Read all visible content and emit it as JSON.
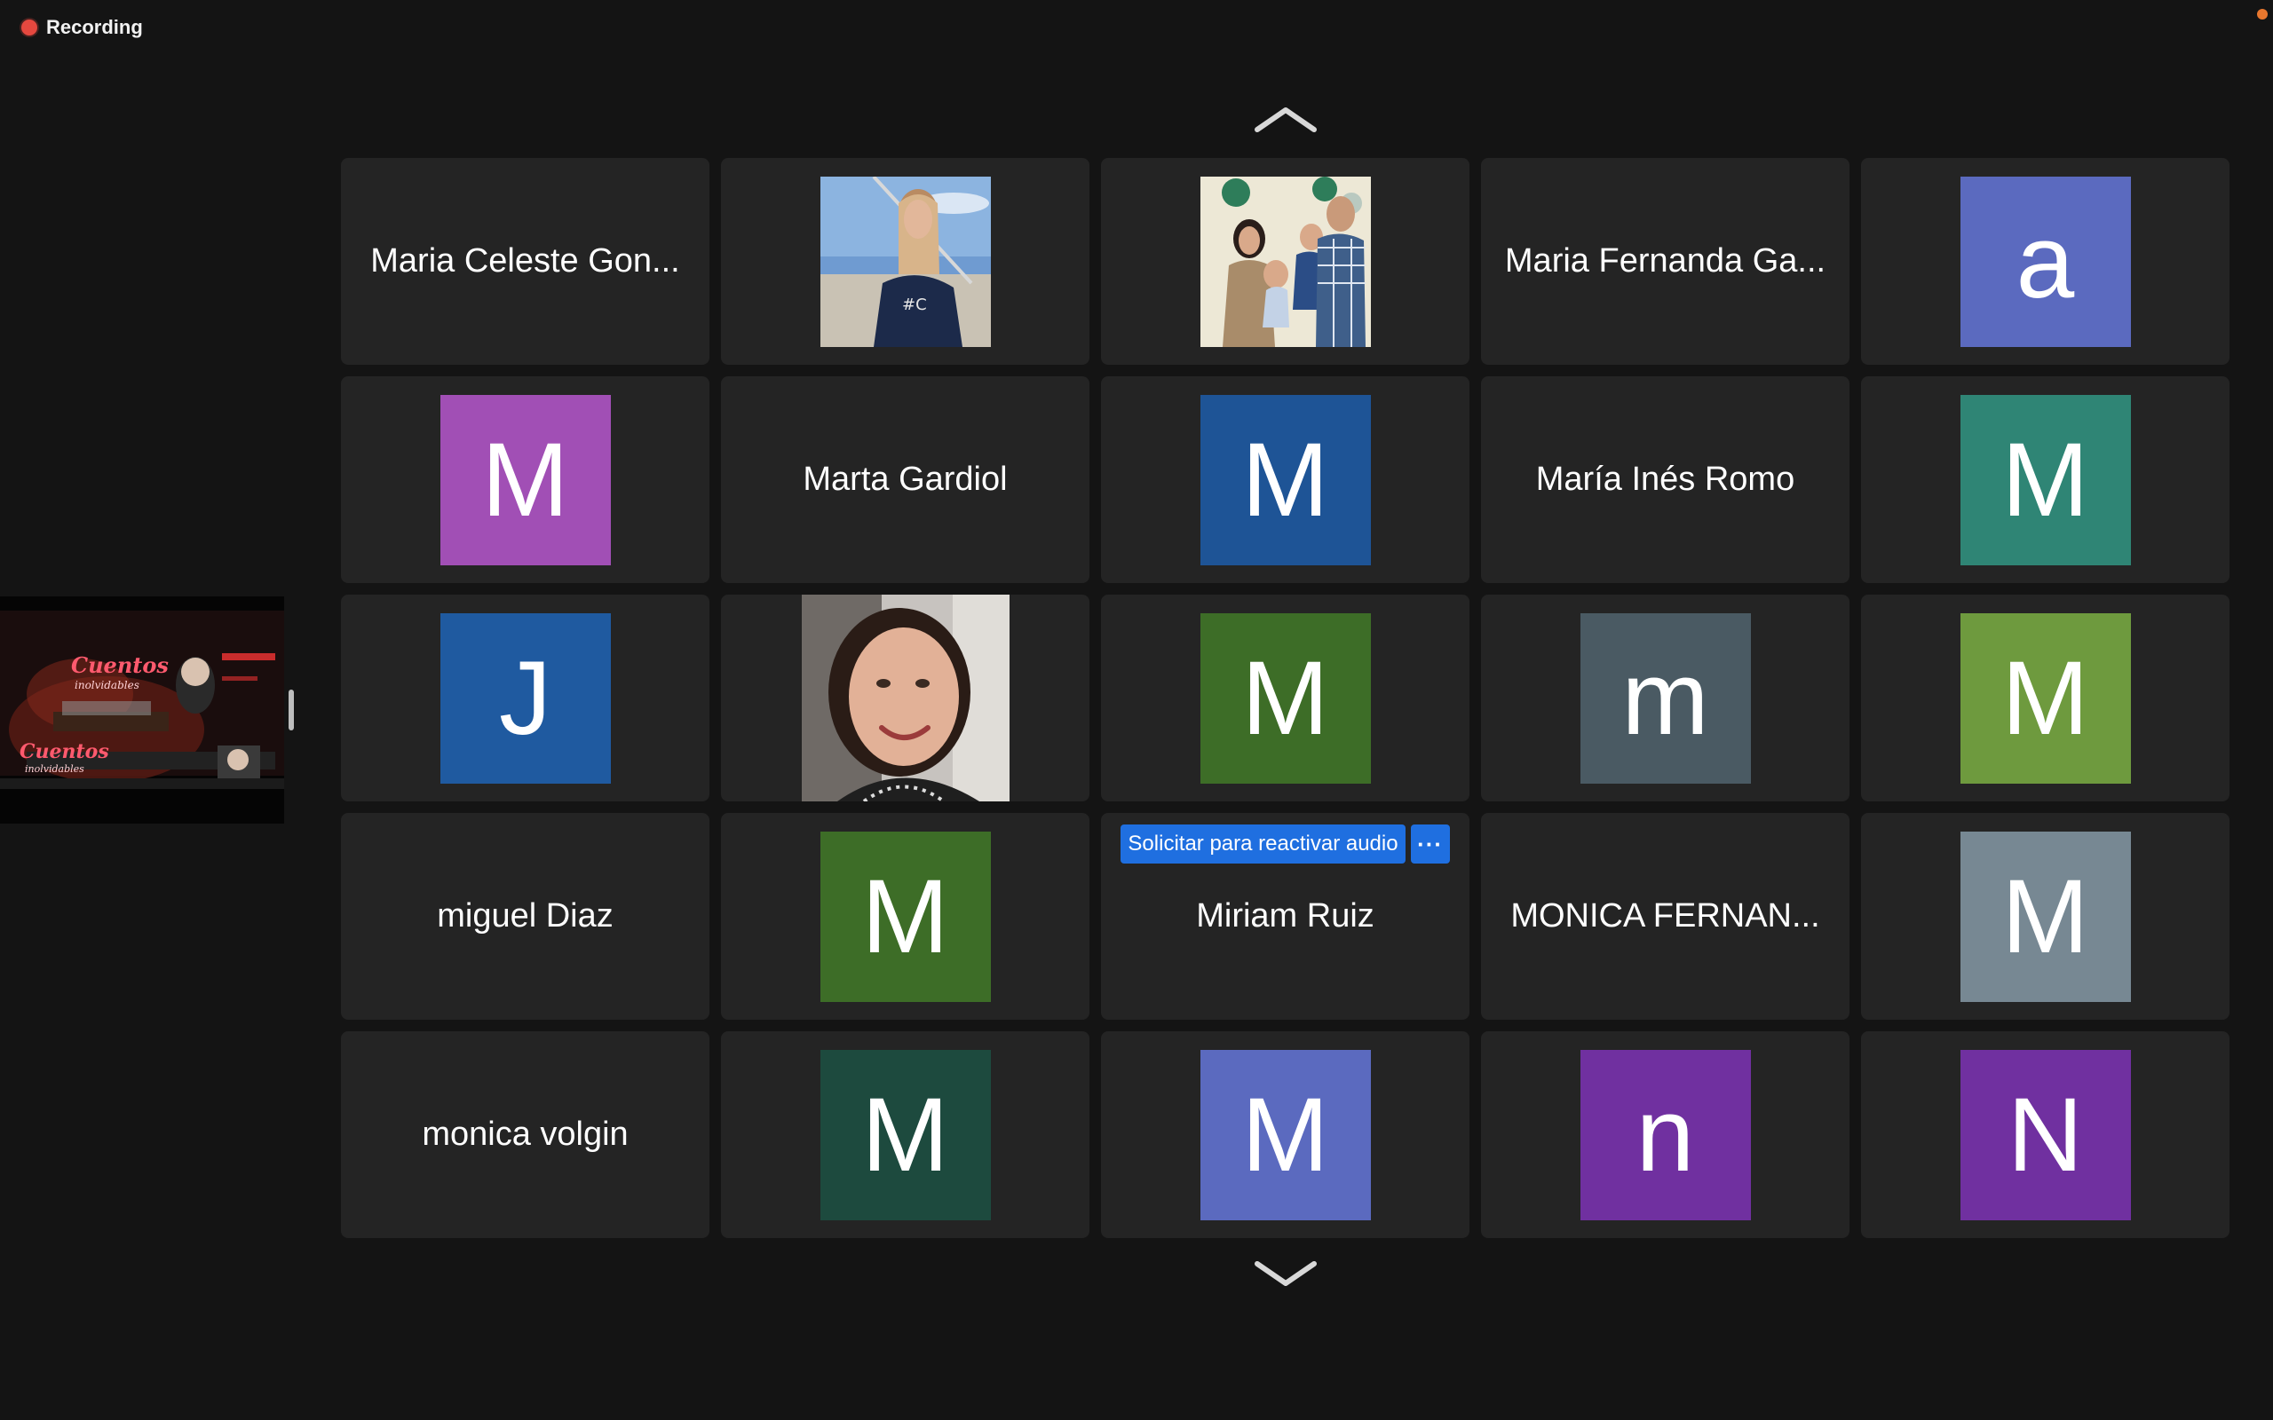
{
  "recording": {
    "label": "Recording"
  },
  "tiles": [
    {
      "name": "Maria Celeste Gon..."
    },
    {
      "photo": "woman-on-boat-photo"
    },
    {
      "photo": "family-photo"
    },
    {
      "name": "Maria Fernanda Ga..."
    },
    {
      "initial": "a",
      "color": "#5b6abf"
    },
    {
      "initial": "M",
      "color": "#a14fb5"
    },
    {
      "name": "Marta Gardiol"
    },
    {
      "initial": "M",
      "color": "#1e5496"
    },
    {
      "name": "María Inés Romo"
    },
    {
      "initial": "M",
      "color": "#2f8575"
    },
    {
      "initial": "J",
      "color": "#1f5aa0"
    },
    {
      "photo": "woman-selfie-photo"
    },
    {
      "initial": "M",
      "color": "#3d6d27"
    },
    {
      "initial": "m",
      "color": "#4a5a63"
    },
    {
      "initial": "M",
      "color": "#6e9a3e"
    },
    {
      "name": "miguel Diaz"
    },
    {
      "initial": "M",
      "color": "#3d6d27"
    },
    {
      "name": "Miriam Ruiz",
      "unmute_label": "Solicitar para reactivar audio",
      "more_label": "···"
    },
    {
      "name": "MONICA FERNAN..."
    },
    {
      "initial": "M",
      "color": "#778893"
    },
    {
      "name": "monica volgin"
    },
    {
      "initial": "M",
      "color": "#1d4a3e"
    },
    {
      "initial": "M",
      "color": "#5b6abf"
    },
    {
      "initial": "n",
      "color": "#7030a0"
    },
    {
      "initial": "N",
      "color": "#7030a0"
    }
  ],
  "shared_screen": {
    "title_line1": "Cuentos",
    "title_line2": "inolvidables"
  },
  "icons": {
    "up": "chevron-up-icon",
    "down": "chevron-down-icon"
  }
}
